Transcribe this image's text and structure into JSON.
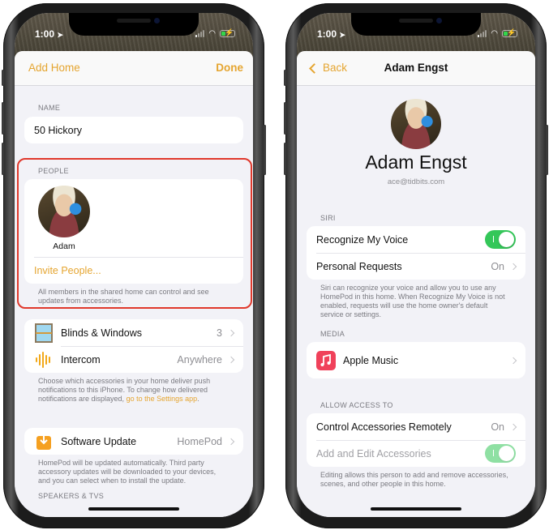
{
  "status_bar": {
    "time": "1:00",
    "location_icon": "location-arrow-icon",
    "wifi_icon": "wifi-icon",
    "battery_icon": "battery-charging-icon"
  },
  "accent_color": "#e5a530",
  "highlight_color": "#e0382b",
  "left": {
    "nav": {
      "left_button": "Add Home",
      "right_button": "Done"
    },
    "name_section": {
      "label": "NAME",
      "value": "50 Hickory"
    },
    "people_section": {
      "label": "PEOPLE",
      "members": [
        {
          "name": "Adam",
          "avatar": "avatar-photo"
        }
      ],
      "invite_label": "Invite People...",
      "footer": "All members in the shared home can control and see updates from accessories."
    },
    "notifications_section": {
      "rows": [
        {
          "icon": "window-blinds-icon",
          "label": "Blinds & Windows",
          "value": "3"
        },
        {
          "icon": "intercom-waveform-icon",
          "label": "Intercom",
          "value": "Anywhere"
        }
      ],
      "footer_text": "Choose which accessories in your home deliver push notifications to this iPhone. To change how delivered notifications are displayed, ",
      "footer_link": "go to the Settings app",
      "footer_end": "."
    },
    "update_section": {
      "row": {
        "icon": "software-update-icon",
        "label": "Software Update",
        "value": "HomePod"
      },
      "footer": "HomePod will be updated automatically. Third party accessory updates will be downloaded to your devices, and you can select when to install the update."
    },
    "speakers_label": "SPEAKERS & TVS"
  },
  "right": {
    "nav": {
      "back_button": "Back",
      "title": "Adam Engst"
    },
    "profile": {
      "name": "Adam Engst",
      "email": "ace@tidbits.com"
    },
    "siri_section": {
      "label": "SIRI",
      "rows": [
        {
          "label": "Recognize My Voice",
          "toggle": true
        },
        {
          "label": "Personal Requests",
          "value": "On"
        }
      ],
      "footer": "Siri can recognize your voice and allow you to use any HomePod in this home. When Recognize My Voice is not enabled, requests will use the home owner's default service or settings."
    },
    "media_section": {
      "label": "MEDIA",
      "row": {
        "icon": "apple-music-icon",
        "label": "Apple Music"
      }
    },
    "access_section": {
      "label": "ALLOW ACCESS TO",
      "rows": [
        {
          "label": "Control Accessories Remotely",
          "value": "On"
        },
        {
          "label": "Add and Edit Accessories",
          "toggle": true,
          "disabled": true
        }
      ],
      "footer": "Editing allows this person to add and remove accessories, scenes, and other people in this home."
    }
  }
}
